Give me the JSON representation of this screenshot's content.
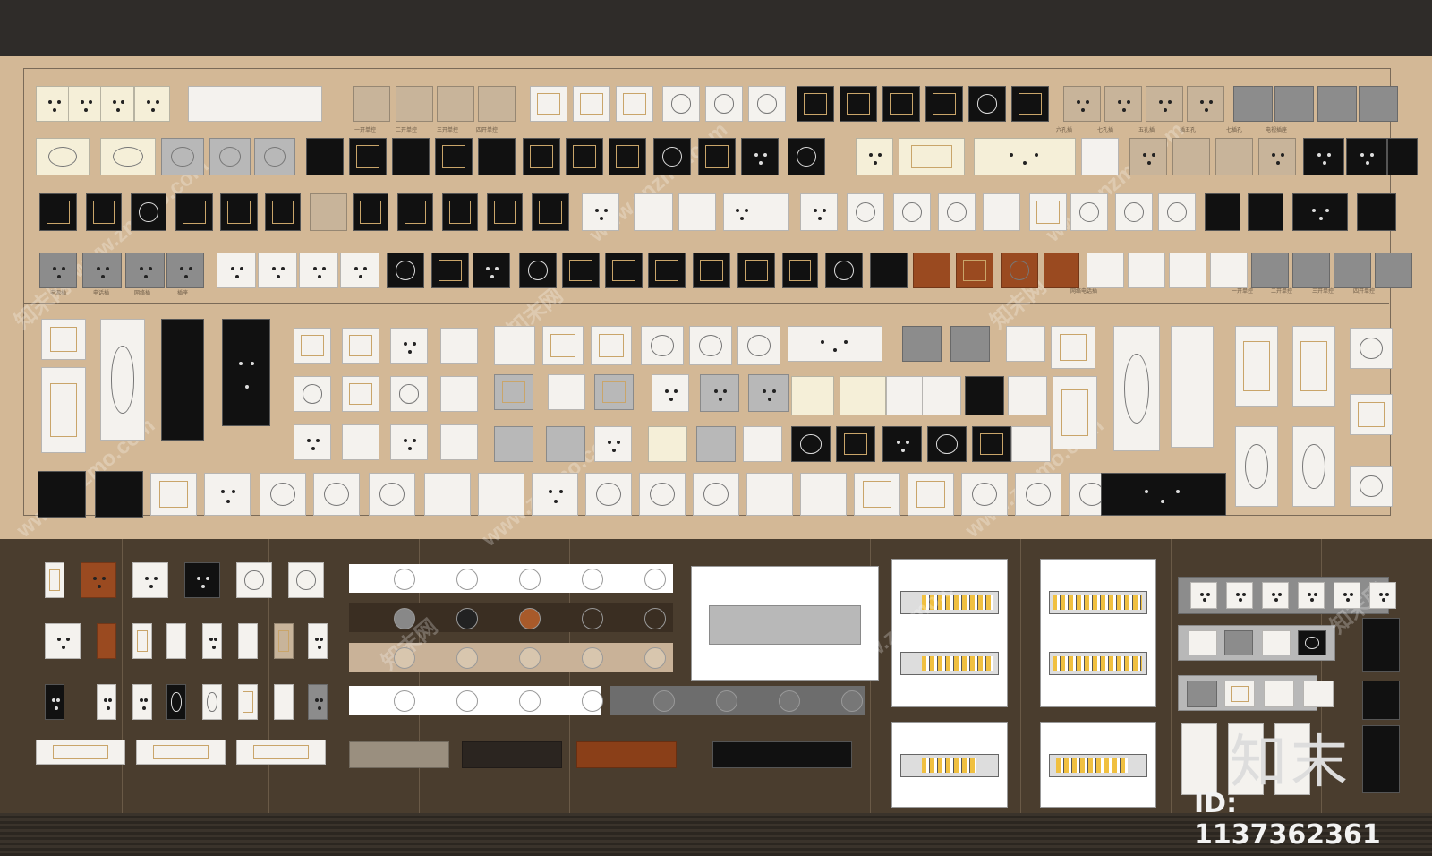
{
  "watermark": {
    "site_text": "www.znzmo.com",
    "brand_text": "知末网",
    "logo_text": "知末",
    "id_label": "ID: 1137362361"
  },
  "captions_row1": [
    "一开单控",
    "二开单控",
    "三开单控",
    "四开单控",
    "六孔插",
    "七孔插",
    "五孔插",
    "插五孔",
    "七插孔",
    "电视插座",
    "网络电话插",
    "一开单控",
    "二开单控",
    "三开单控",
    "四开单控"
  ],
  "captions_row2": [
    "电源插",
    "电话插",
    "网络插",
    "插座"
  ],
  "colors": {
    "beige": "#d3b896",
    "dark": "#4a3d2e",
    "top": "#2f2c29",
    "brown_accent": "#9a4a20"
  }
}
